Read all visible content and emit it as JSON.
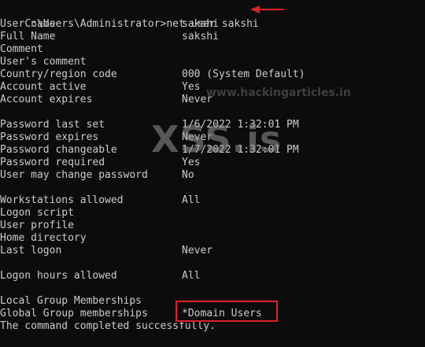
{
  "prompt": "C:\\Users\\Administrator>",
  "command": "net user sakshi",
  "fields": [
    {
      "key": "User name",
      "value": "sakshi"
    },
    {
      "key": "Full Name",
      "value": "sakshi"
    },
    {
      "key": "Comment",
      "value": ""
    },
    {
      "key": "User's comment",
      "value": ""
    },
    {
      "key": "Country/region code",
      "value": "000 (System Default)"
    },
    {
      "key": "Account active",
      "value": "Yes"
    },
    {
      "key": "Account expires",
      "value": "Never"
    },
    {
      "key": "Password last set",
      "value": "1/6/2022 1:32:01 PM"
    },
    {
      "key": "Password expires",
      "value": "Never"
    },
    {
      "key": "Password changeable",
      "value": "1/7/2022 1:32:01 PM"
    },
    {
      "key": "Password required",
      "value": "Yes"
    },
    {
      "key": "User may change password",
      "value": "No"
    },
    {
      "key": "Workstations allowed",
      "value": "All"
    },
    {
      "key": "Logon script",
      "value": ""
    },
    {
      "key": "User profile",
      "value": ""
    },
    {
      "key": "Home directory",
      "value": ""
    },
    {
      "key": "Last logon",
      "value": "Never"
    },
    {
      "key": "Logon hours allowed",
      "value": "All"
    },
    {
      "key": "Local Group Memberships",
      "value": ""
    },
    {
      "key": "Global Group memberships",
      "value": "*Domain Users"
    }
  ],
  "completion": "The command completed successfully.",
  "watermark": {
    "small_text": "www.hackingarticles.in",
    "large_text": "XSS.is"
  },
  "colors": {
    "background": "#0c0c0c",
    "text": "#cccccc",
    "annotation": "#e0202a"
  }
}
